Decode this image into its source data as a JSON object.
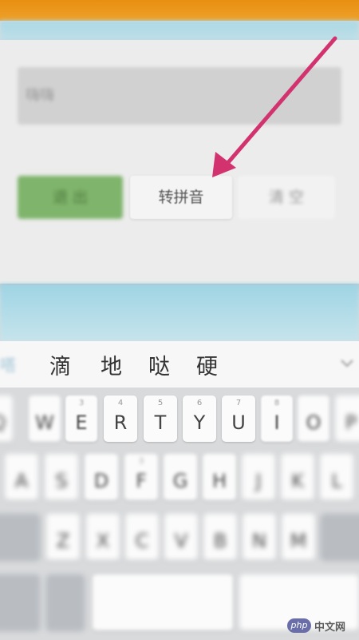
{
  "app": {
    "input_value": "嗨嗨",
    "buttons": {
      "out_label": "退 出",
      "pinyin_label": "转拼音",
      "clear_label": "清 空"
    },
    "accent_green": "#7fb46c",
    "top_bar_color": "#e88f10"
  },
  "candidates": {
    "left_cut": "嗒",
    "items": [
      "滴",
      "地",
      "哒",
      "硬"
    ],
    "chevron": "chevron-down-icon"
  },
  "keyboard": {
    "row1": [
      {
        "hint": "",
        "key": "Q"
      },
      {
        "hint": "",
        "key": "W"
      },
      {
        "hint": "3",
        "key": "E"
      },
      {
        "hint": "4",
        "key": "R"
      },
      {
        "hint": "5",
        "key": "T"
      },
      {
        "hint": "6",
        "key": "Y"
      },
      {
        "hint": "7",
        "key": "U"
      },
      {
        "hint": "8",
        "key": "I"
      },
      {
        "hint": "",
        "key": "O"
      },
      {
        "hint": "",
        "key": "P"
      }
    ],
    "row2": [
      {
        "hint": "",
        "key": "A"
      },
      {
        "hint": "",
        "key": "S"
      },
      {
        "hint": "",
        "key": "D"
      },
      {
        "hint": "3",
        "key": "F"
      },
      {
        "hint": "",
        "key": "G"
      },
      {
        "hint": "",
        "key": "H"
      },
      {
        "hint": "",
        "key": "J"
      },
      {
        "hint": "",
        "key": "K"
      },
      {
        "hint": "",
        "key": "L"
      }
    ],
    "row3": [
      {
        "hint": "",
        "key": "Z"
      },
      {
        "hint": "",
        "key": "X"
      },
      {
        "hint": "",
        "key": "C"
      },
      {
        "hint": "",
        "key": "V"
      },
      {
        "hint": "",
        "key": "B"
      },
      {
        "hint": "",
        "key": "N"
      },
      {
        "hint": "",
        "key": "M"
      }
    ]
  },
  "annotation": {
    "arrow_color": "#d2336f"
  },
  "watermark": {
    "badge": "php",
    "text": "中文网"
  }
}
